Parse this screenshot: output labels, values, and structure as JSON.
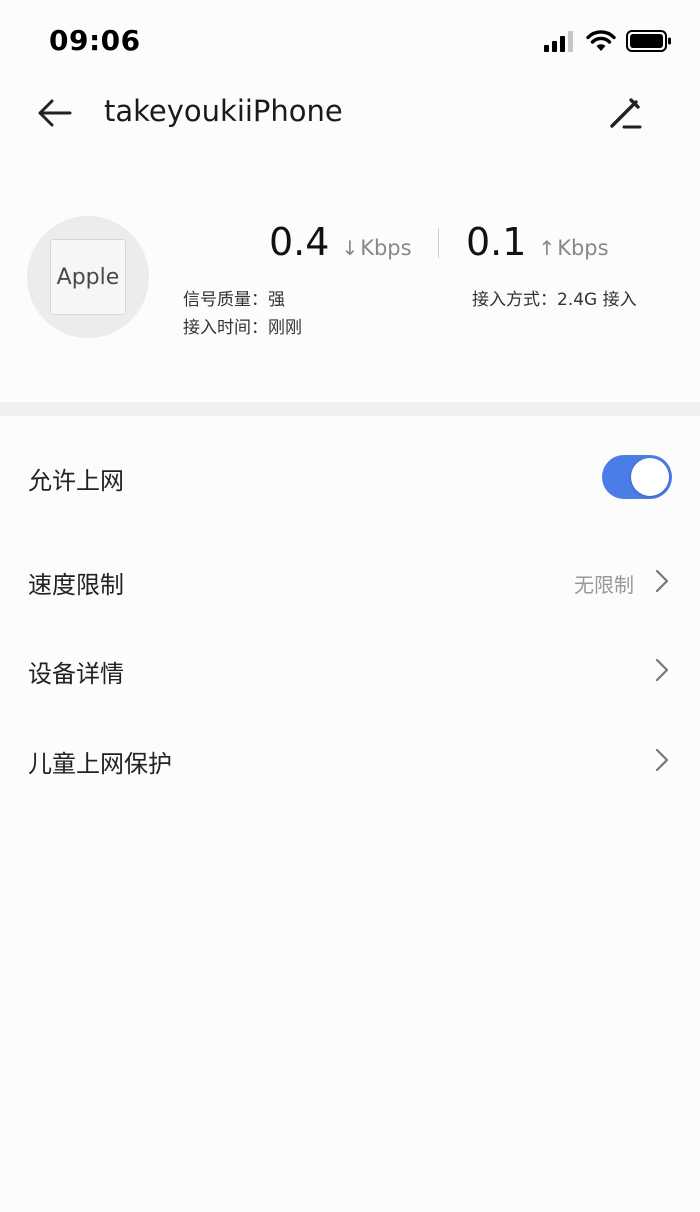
{
  "status_bar": {
    "time": "09:06",
    "icons": [
      "cellular-signal-icon",
      "wifi-icon",
      "battery-icon"
    ]
  },
  "header": {
    "title": "takeyoukiiPhone",
    "back_icon": "back-arrow-icon",
    "edit_icon": "edit-pen-icon"
  },
  "device": {
    "avatar_label": "Apple",
    "download_speed": "0.4",
    "download_arrow": "↓",
    "download_unit": "Kbps",
    "upload_speed": "0.1",
    "upload_arrow": "↑",
    "upload_unit": "Kbps",
    "signal_quality": "信号质量：强",
    "access_time": "接入时间：刚刚",
    "access_mode": "接入方式：2.4G 接入"
  },
  "settings": {
    "allow_internet_label": "允许上网",
    "allow_internet_enabled": true,
    "speed_limit_label": "速度限制",
    "speed_limit_value": "无限制",
    "device_details_label": "设备详情",
    "child_protection_label": "儿童上网保护"
  },
  "colors": {
    "toggle_on": "#4a7ee6",
    "background": "#fcfcfc",
    "section_gap": "#f0f0f0"
  }
}
